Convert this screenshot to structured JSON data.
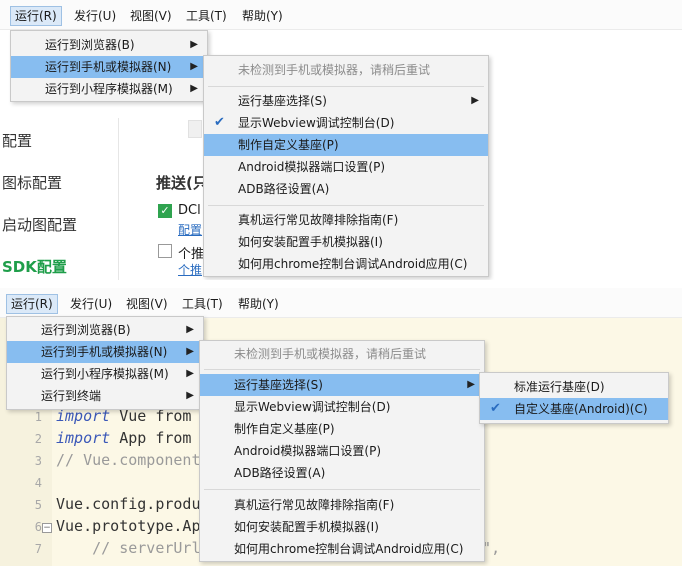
{
  "menubar": [
    {
      "label": "运行(R)",
      "active": true
    },
    {
      "label": "发行(U)"
    },
    {
      "label": "视图(V)"
    },
    {
      "label": "工具(T)"
    },
    {
      "label": "帮助(Y)"
    }
  ],
  "run_menu_top": [
    {
      "label": "运行到浏览器(B)"
    },
    {
      "label": "运行到手机或模拟器(N)"
    },
    {
      "label": "运行到小程序模拟器(M)"
    }
  ],
  "run_menu_bottom": [
    {
      "label": "运行到浏览器(B)"
    },
    {
      "label": "运行到手机或模拟器(N)"
    },
    {
      "label": "运行到小程序模拟器(M)"
    },
    {
      "label": "运行到终端"
    }
  ],
  "device_menu_top": {
    "notice": "未检测到手机或模拟器，请稍后重试",
    "items": [
      {
        "label": "运行基座选择(S)"
      },
      {
        "label": "显示Webview调试控制台(D)"
      },
      {
        "label": "制作自定义基座(P)"
      },
      {
        "label": "Android模拟器端口设置(P)"
      },
      {
        "label": "ADB路径设置(A)"
      },
      {
        "label": "真机运行常见故障排除指南(F)"
      },
      {
        "label": "如何安装配置手机模拟器(I)"
      },
      {
        "label": "如何用chrome控制台调试Android应用(C)"
      }
    ]
  },
  "device_menu_bottom": {
    "notice": "未检测到手机或模拟器，请稍后重试",
    "items": [
      {
        "label": "运行基座选择(S)"
      },
      {
        "label": "显示Webview调试控制台(D)"
      },
      {
        "label": "制作自定义基座(P)"
      },
      {
        "label": "Android模拟器端口设置(P)"
      },
      {
        "label": "ADB路径设置(A)"
      },
      {
        "label": "真机运行常见故障排除指南(F)"
      },
      {
        "label": "如何安装配置手机模拟器(I)"
      },
      {
        "label": "如何用chrome控制台调试Android应用(C)"
      }
    ]
  },
  "base_submenu": [
    {
      "label": "标准运行基座(D)"
    },
    {
      "label": "自定义基座(Android)(C)"
    }
  ],
  "settings_bg": {
    "side_items": [
      "配置",
      "图标配置",
      "启动图配置",
      "SDK配置"
    ],
    "push_heading": "推送(只",
    "option1": "DCl",
    "option1_link": "配置",
    "option2": "个推",
    "option2_link": "个推"
  },
  "code_bg": {
    "lines": [
      {
        "num": "1",
        "kw": "import",
        "rest": " Vue from"
      },
      {
        "num": "2",
        "kw": "import",
        "rest": " App from"
      },
      {
        "num": "3",
        "kw": "",
        "rest": "// Vue.component"
      },
      {
        "num": "4",
        "kw": "",
        "rest": ""
      },
      {
        "num": "5",
        "kw": "",
        "rest": "Vue.config.produ"
      },
      {
        "num": "6",
        "kw": "",
        "rest": "Vue.prototype.Ap"
      },
      {
        "num": "7",
        "kw": "",
        "rest": "    // serverUrl"
      }
    ],
    "tail": "om\","
  },
  "colors": {
    "highlight": "#87bdf0",
    "menu_bg": "#f3f3f3",
    "check": "#2a6cc0",
    "green": "#1f9e4a"
  }
}
